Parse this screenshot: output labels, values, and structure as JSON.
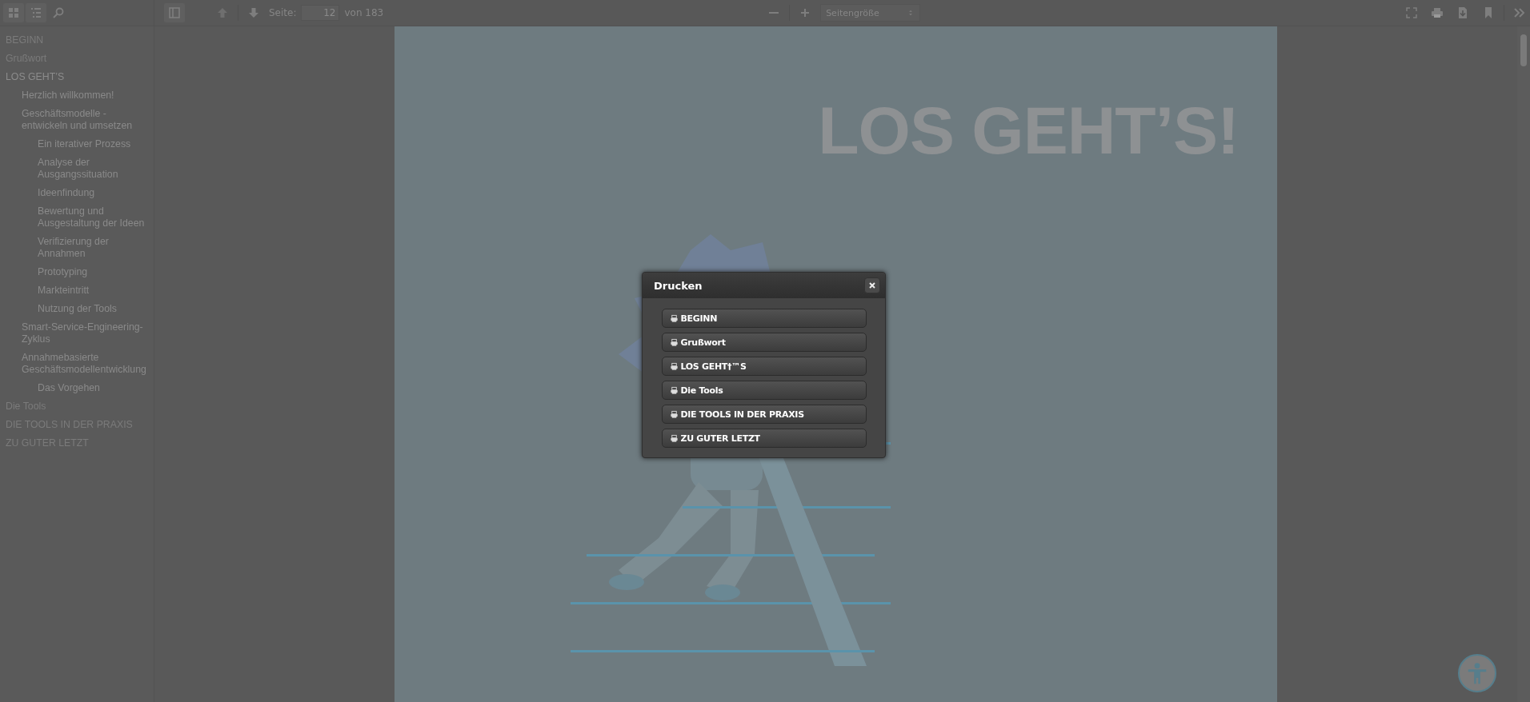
{
  "toolbar": {
    "page_label": "Seite:",
    "page_value": "12",
    "page_total": "von 183",
    "zoom_select": "Seitengröße"
  },
  "sidebar": {
    "items": [
      {
        "label": "BEGINN"
      },
      {
        "label": "Grußwort"
      },
      {
        "label": "LOS GEHT’S",
        "children": [
          {
            "label": "Herzlich willkommen!"
          },
          {
            "label": "Geschäftsmodelle - entwickeln und umsetzen",
            "children": [
              {
                "label": "Ein iterativer Prozess"
              },
              {
                "label": "Analyse der Ausgangssituation"
              },
              {
                "label": "Ideenfindung"
              },
              {
                "label": "Bewertung und Ausgestaltung der Ideen"
              },
              {
                "label": "Verifizierung der Annahmen"
              },
              {
                "label": "Prototyping"
              },
              {
                "label": "Markteintritt"
              },
              {
                "label": "Nutzung der Tools"
              }
            ]
          },
          {
            "label": "Smart-Service-Engineering-Zyklus"
          },
          {
            "label": "Annahmebasierte Geschäftsmodellentwicklung",
            "children": [
              {
                "label": "Das Vorgehen"
              }
            ]
          }
        ]
      },
      {
        "label": "Die Tools"
      },
      {
        "label": "DIE TOOLS IN DER PRAXIS"
      },
      {
        "label": "ZU GUTER LETZT"
      }
    ]
  },
  "page": {
    "heading": "LOS GEHT’S!"
  },
  "dialog": {
    "title": "Drucken",
    "buttons": [
      "BEGINN",
      "Grußwort",
      "LOS GEHT†™S",
      "Die Tools",
      "DIE TOOLS IN DER PRAXIS",
      "ZU GUTER LETZT"
    ]
  }
}
